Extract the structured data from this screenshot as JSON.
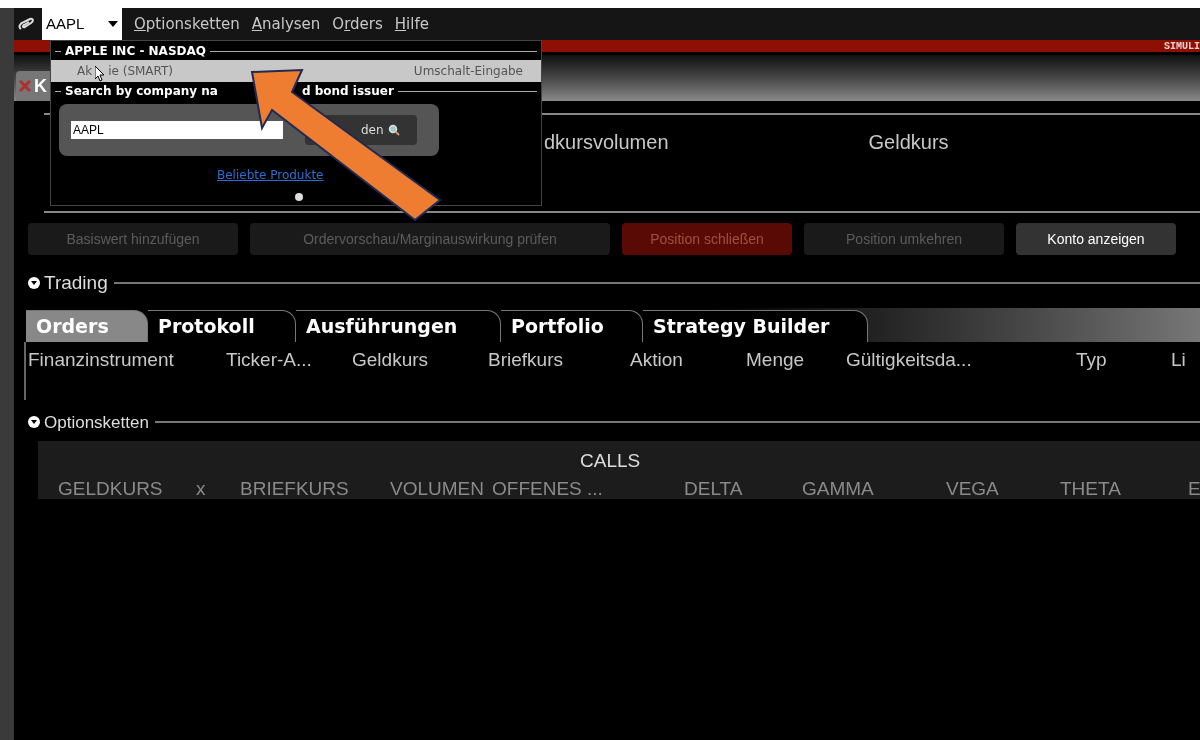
{
  "menu_bar": {
    "symbol": "AAPL",
    "items": [
      {
        "accel": "O",
        "after": "ptionsketten"
      },
      {
        "accel": "A",
        "after": "nalysen"
      },
      {
        "before": "O",
        "accel": "r",
        "after": "ders"
      },
      {
        "accel": "H",
        "after": "ilfe"
      }
    ]
  },
  "mode_banner": "SIMULI",
  "window_tab": {
    "label": "K"
  },
  "quote_header": {
    "columns": [
      "dkursvolumen",
      "Geldkurs"
    ]
  },
  "action_buttons": [
    {
      "label": "Basiswert hinzufügen",
      "kind": "disabled"
    },
    {
      "label": "Ordervorschau/Marginauswirkung prüfen",
      "kind": "disabled"
    },
    {
      "label": "Position schließen",
      "kind": "danger"
    },
    {
      "label": "Position umkehren",
      "kind": "disabled"
    },
    {
      "label": "Konto anzeigen",
      "kind": "normal"
    }
  ],
  "trading": {
    "title": "Trading",
    "tabs": [
      {
        "label": "Orders",
        "selected": true
      },
      {
        "label": "Protokoll",
        "selected": false
      },
      {
        "label": "Ausführungen",
        "selected": false
      },
      {
        "label": "Portfolio",
        "selected": false
      },
      {
        "label": "Strategy Builder",
        "selected": false
      }
    ],
    "columns": [
      "Finanzinstrument",
      "Ticker-A...",
      "Geldkurs",
      "Briefkurs",
      "Aktion",
      "Menge",
      "Gültigkeitsda...",
      "Typ",
      "Li"
    ]
  },
  "option_chains": {
    "title": "Optionsketten",
    "group": "CALLS",
    "columns": [
      "GELDKURS",
      "x",
      "BRIEFKURS",
      "VOLUMEN",
      "OFFENES ...",
      "DELTA",
      "GAMMA",
      "VEGA",
      "THETA",
      "E"
    ]
  },
  "dropdown": {
    "heading": "APPLE INC - NASDAQ",
    "items": [
      {
        "label_parts": [
          "Ak",
          "ie (SMART)"
        ],
        "shortcut": "Umschalt-Eingabe",
        "selected": true
      }
    ],
    "search_heading": [
      "Search by company na",
      "d bond issuer"
    ],
    "search_value": "AAPL",
    "search_button": "den",
    "link": "Beliebte Produkte"
  }
}
